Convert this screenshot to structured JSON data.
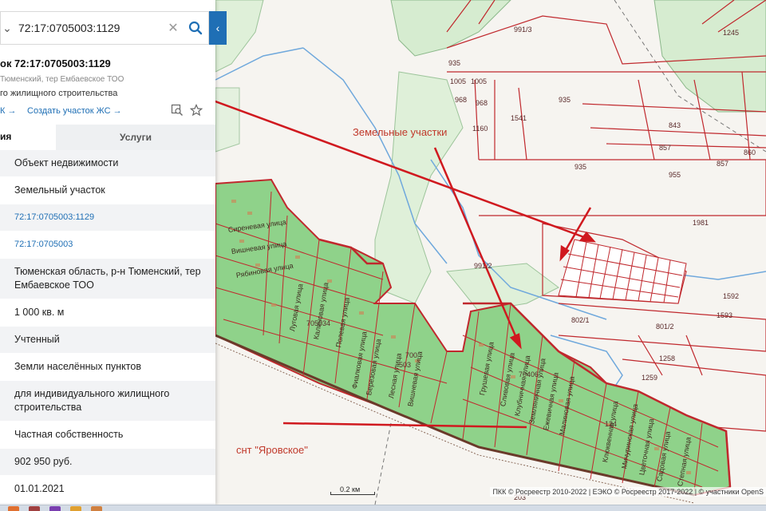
{
  "search": {
    "value": "72:17:0705003:1129",
    "placeholder": ""
  },
  "object": {
    "title": "ок 72:17:0705003:1129",
    "address": "Тюменский, тер Ембаевское ТОО",
    "purpose": "го жилищного строительства",
    "link_1": "К →",
    "link_2": "Создать участок ЖС →"
  },
  "tabs": {
    "info": "ия",
    "services": "Услуги"
  },
  "rows": [
    {
      "text": "Объект недвижимости",
      "link": false
    },
    {
      "text": "Земельный участок",
      "link": false
    },
    {
      "text": "72:17:0705003:1129",
      "link": true
    },
    {
      "text": "72:17:0705003",
      "link": true
    },
    {
      "text": "Тюменская область, р-н Тюменский, тер Ембаевское ТОО",
      "link": false
    },
    {
      "text": "1 000 кв. м",
      "link": false
    },
    {
      "text": "Учтенный",
      "link": false
    },
    {
      "text": "Земли населённых пунктов",
      "link": false
    },
    {
      "text": "для индивидуального жилищного строительства",
      "link": false
    },
    {
      "text": "Частная собственность",
      "link": false
    },
    {
      "text": "902 950 руб.",
      "link": false
    },
    {
      "text": "01.01.2021",
      "link": false
    },
    {
      "text": "-",
      "link": false
    }
  ],
  "map": {
    "area_label_1": "Земельные участки",
    "area_label_2": "снт \"Яровское\"",
    "scale": "0.2 км",
    "attribution": "ПКК © Росреестр 2010-2022 | ЕЭКО © Росреестр 2017-2022 | © участники OpenS",
    "parcels": [
      "991/3",
      "1245",
      "935",
      "1005",
      "1005",
      "968",
      "968",
      "935",
      "1541",
      "1160",
      "843",
      "857",
      "860",
      "857",
      "935",
      "955",
      "1981",
      "991/2",
      "1592",
      "1593",
      "802/1",
      "801/2",
      "1258",
      "1259",
      "705034",
      "700",
      "503",
      "70406",
      "124",
      "203"
    ],
    "streets": [
      "Сиреневая улица",
      "Вишневая улица",
      "Рябиновая улица",
      "Луговая улица",
      "Калиновая улица",
      "Полевая улица",
      "Фиалковая улица",
      "Березовая улица",
      "Лесная улица",
      "Вишневая улица",
      "Грушевая улица",
      "Сливовая улица",
      "Клубничная улица",
      "Земляничная улица",
      "Ежевичная улица",
      "Малиновая улица",
      "Клюквенная улица",
      "Мичуринская улица",
      "Цветочная улица",
      "Садовая улица",
      "Степная улица"
    ],
    "colors": {
      "parcel_line": "#c0282d",
      "green_zone": "#8fd28a",
      "forest": "#d6ecd0",
      "river": "#6fa8dc",
      "arrow": "#d0191f"
    }
  }
}
